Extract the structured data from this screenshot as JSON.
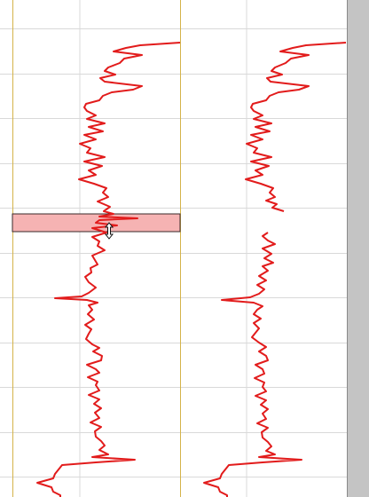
{
  "window": {
    "title": ""
  },
  "colors": {
    "background": "#ffffff",
    "grid": "#d9d9d9",
    "track_border": "#d4b34a",
    "curve": "#e21b1b",
    "selection_fill": "#f6b3b3",
    "selection_border": "#3a2a2a",
    "scrollbar": "#c4c4c4"
  },
  "cursor": {
    "icon": "vertical-resize-cursor-icon"
  },
  "chart_data": {
    "type": "line",
    "grid": true,
    "series": [
      {
        "values": [
          [
            0,
            203
          ],
          [
            48,
            203
          ],
          [
            51,
            158
          ],
          [
            54,
            142
          ],
          [
            58,
            128
          ],
          [
            62,
            160
          ],
          [
            66,
            140
          ],
          [
            71,
            135
          ],
          [
            76,
            122
          ],
          [
            80,
            118
          ],
          [
            84,
            130
          ],
          [
            88,
            113
          ],
          [
            92,
            118
          ],
          [
            97,
            160
          ],
          [
            101,
            150
          ],
          [
            104,
            126
          ],
          [
            108,
            116
          ],
          [
            113,
            112
          ],
          [
            117,
            97
          ],
          [
            121,
            95
          ],
          [
            125,
            98
          ],
          [
            130,
            108
          ],
          [
            134,
            98
          ],
          [
            139,
            118
          ],
          [
            143,
            100
          ],
          [
            148,
            116
          ],
          [
            152,
            95
          ],
          [
            157,
            108
          ],
          [
            162,
            90
          ],
          [
            167,
            102
          ],
          [
            172,
            98
          ],
          [
            177,
            118
          ],
          [
            182,
            95
          ],
          [
            187,
            115
          ],
          [
            192,
            100
          ],
          [
            197,
            108
          ],
          [
            202,
            89
          ],
          [
            207,
            106
          ],
          [
            212,
            120
          ],
          [
            217,
            116
          ],
          [
            222,
            122
          ],
          [
            227,
            110
          ],
          [
            233,
            124
          ],
          [
            238,
            117
          ],
          [
            241,
            128
          ],
          [
            244,
            112
          ],
          [
            246,
            155
          ],
          [
            248,
            112
          ],
          [
            251,
            108
          ],
          [
            254,
            132
          ],
          [
            257,
            104
          ],
          [
            262,
            120
          ],
          [
            267,
            104
          ],
          [
            272,
            112
          ],
          [
            277,
            110
          ],
          [
            282,
            118
          ],
          [
            288,
            104
          ],
          [
            293,
            107
          ],
          [
            298,
            110
          ],
          [
            302,
            102
          ],
          [
            307,
            103
          ],
          [
            312,
            96
          ],
          [
            318,
            100
          ],
          [
            324,
            108
          ],
          [
            330,
            100
          ],
          [
            334,
            92
          ],
          [
            336,
            62
          ],
          [
            338,
            98
          ],
          [
            341,
            110
          ],
          [
            344,
            100
          ],
          [
            349,
            104
          ],
          [
            354,
            99
          ],
          [
            360,
            106
          ],
          [
            366,
            96
          ],
          [
            371,
            103
          ],
          [
            376,
            100
          ],
          [
            382,
            97
          ],
          [
            388,
            104
          ],
          [
            392,
            112
          ],
          [
            396,
            105
          ],
          [
            401,
            115
          ],
          [
            406,
            114
          ],
          [
            411,
            98
          ],
          [
            416,
            108
          ],
          [
            420,
            112
          ],
          [
            425,
            99
          ],
          [
            430,
            110
          ],
          [
            434,
            108
          ],
          [
            440,
            112
          ],
          [
            445,
            100
          ],
          [
            450,
            112
          ],
          [
            455,
            106
          ],
          [
            460,
            114
          ],
          [
            465,
            107
          ],
          [
            471,
            112
          ],
          [
            476,
            102
          ],
          [
            481,
            114
          ],
          [
            486,
            107
          ],
          [
            492,
            108
          ],
          [
            497,
            114
          ],
          [
            502,
            118
          ],
          [
            507,
            112
          ],
          [
            512,
            122
          ],
          [
            515,
            104
          ],
          [
            518,
            152
          ],
          [
            521,
            108
          ],
          [
            524,
            70
          ],
          [
            529,
            66
          ],
          [
            534,
            62
          ],
          [
            539,
            60
          ],
          [
            544,
            42
          ],
          [
            549,
            58
          ],
          [
            554,
            60
          ],
          [
            558,
            68
          ],
          [
            560,
            68
          ]
        ]
      },
      {
        "values": [
          [
            0,
            390
          ],
          [
            48,
            390
          ],
          [
            51,
            345
          ],
          [
            54,
            330
          ],
          [
            58,
            316
          ],
          [
            62,
            348
          ],
          [
            66,
            328
          ],
          [
            71,
            322
          ],
          [
            76,
            310
          ],
          [
            80,
            306
          ],
          [
            84,
            318
          ],
          [
            88,
            301
          ],
          [
            92,
            305
          ],
          [
            97,
            348
          ],
          [
            101,
            337
          ],
          [
            104,
            314
          ],
          [
            108,
            304
          ],
          [
            113,
            300
          ],
          [
            117,
            285
          ],
          [
            121,
            283
          ],
          [
            125,
            286
          ],
          [
            130,
            296
          ],
          [
            134,
            286
          ],
          [
            139,
            306
          ],
          [
            143,
            288
          ],
          [
            148,
            304
          ],
          [
            152,
            283
          ],
          [
            157,
            296
          ],
          [
            162,
            278
          ],
          [
            167,
            290
          ],
          [
            172,
            286
          ],
          [
            177,
            306
          ],
          [
            182,
            283
          ],
          [
            187,
            303
          ],
          [
            192,
            288
          ],
          [
            197,
            296
          ],
          [
            202,
            277
          ],
          [
            207,
            294
          ],
          [
            212,
            308
          ],
          [
            217,
            304
          ],
          [
            222,
            310
          ],
          [
            226,
            300
          ],
          [
            230,
            312
          ],
          [
            234,
            307
          ],
          [
            238,
            320
          ],
          [
            262,
            302
          ],
          [
            266,
            296
          ],
          [
            271,
            302
          ],
          [
            275,
            310
          ],
          [
            280,
            296
          ],
          [
            286,
            306
          ],
          [
            291,
            298
          ],
          [
            296,
            308
          ],
          [
            300,
            296
          ],
          [
            305,
            302
          ],
          [
            311,
            292
          ],
          [
            316,
            300
          ],
          [
            321,
            290
          ],
          [
            326,
            298
          ],
          [
            331,
            292
          ],
          [
            335,
            282
          ],
          [
            338,
            250
          ],
          [
            341,
            286
          ],
          [
            345,
            296
          ],
          [
            349,
            290
          ],
          [
            354,
            286
          ],
          [
            359,
            294
          ],
          [
            364,
            286
          ],
          [
            370,
            292
          ],
          [
            375,
            288
          ],
          [
            380,
            284
          ],
          [
            386,
            292
          ],
          [
            391,
            300
          ],
          [
            396,
            292
          ],
          [
            401,
            300
          ],
          [
            406,
            302
          ],
          [
            411,
            288
          ],
          [
            416,
            296
          ],
          [
            421,
            298
          ],
          [
            426,
            287
          ],
          [
            431,
            298
          ],
          [
            436,
            296
          ],
          [
            441,
            300
          ],
          [
            446,
            288
          ],
          [
            451,
            300
          ],
          [
            456,
            294
          ],
          [
            461,
            302
          ],
          [
            466,
            296
          ],
          [
            472,
            300
          ],
          [
            477,
            290
          ],
          [
            482,
            302
          ],
          [
            487,
            295
          ],
          [
            493,
            296
          ],
          [
            498,
            302
          ],
          [
            503,
            306
          ],
          [
            508,
            300
          ],
          [
            512,
            310
          ],
          [
            515,
            292
          ],
          [
            518,
            340
          ],
          [
            521,
            296
          ],
          [
            524,
            258
          ],
          [
            529,
            254
          ],
          [
            534,
            250
          ],
          [
            539,
            248
          ],
          [
            544,
            230
          ],
          [
            549,
            246
          ],
          [
            554,
            248
          ],
          [
            558,
            256
          ],
          [
            560,
            256
          ]
        ]
      }
    ]
  }
}
